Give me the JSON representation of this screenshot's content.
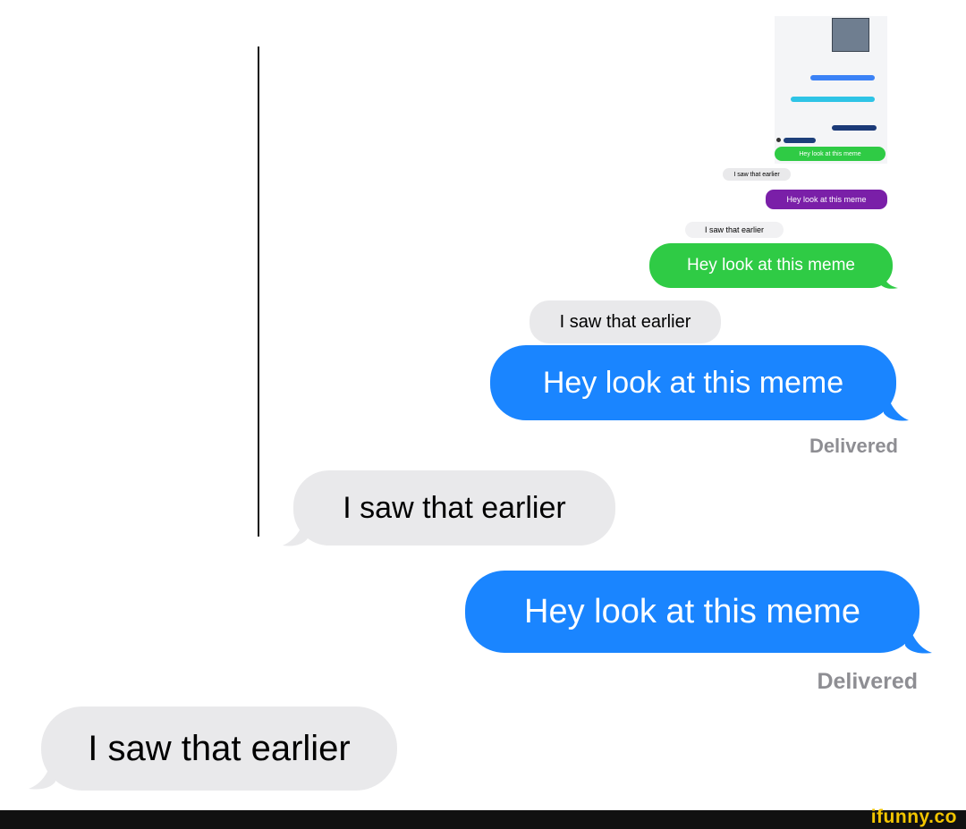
{
  "messages": [
    {
      "text": "Hey look at this meme",
      "sender": "me",
      "color": "#2fcb45"
    },
    {
      "text": "I saw that earlier",
      "sender": "them"
    },
    {
      "text": "Hey look at this meme",
      "sender": "me",
      "color": "#7a1fa8"
    },
    {
      "text": "I saw that earlier",
      "sender": "them"
    },
    {
      "text": "Hey look at this meme",
      "sender": "me",
      "color": "#2fcb45"
    },
    {
      "text": "I saw that earlier",
      "sender": "them"
    },
    {
      "text": "Hey look at this meme",
      "sender": "me",
      "color": "#1a85ff"
    },
    {
      "text": "Delivered",
      "type": "status"
    },
    {
      "text": "I saw that earlier",
      "sender": "them"
    },
    {
      "text": "Hey look at this meme",
      "sender": "me",
      "color": "#1a85ff"
    },
    {
      "text": "Delivered",
      "type": "status"
    },
    {
      "text": "I saw that earlier",
      "sender": "them"
    }
  ],
  "watermark": "ifunny.co",
  "colors": {
    "imessage_blue": "#1a85ff",
    "sms_green": "#2fcb45",
    "purple": "#7a1fa8",
    "received_gray": "#e9e9eb",
    "status_gray": "#8e8e93",
    "watermark_yellow": "#f2c500"
  }
}
